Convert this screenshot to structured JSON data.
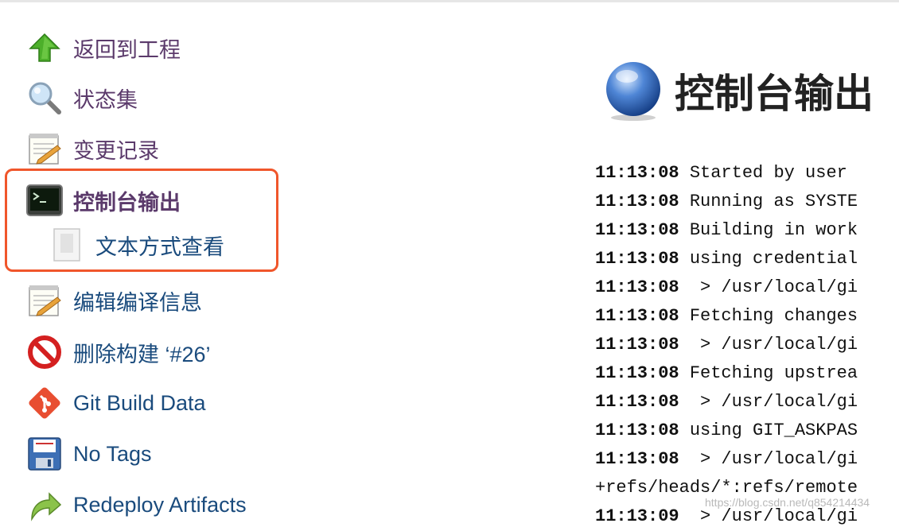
{
  "sidebar": {
    "items": [
      {
        "label": "返回到工程",
        "icon": "up-arrow-icon"
      },
      {
        "label": "状态集",
        "icon": "magnifier-icon"
      },
      {
        "label": "变更记录",
        "icon": "notepad-icon"
      },
      {
        "label": "控制台输出",
        "icon": "terminal-icon"
      },
      {
        "label": "文本方式查看",
        "icon": "document-icon"
      },
      {
        "label": "编辑编译信息",
        "icon": "notepad-icon"
      },
      {
        "label": "删除构建 ‘#26’",
        "icon": "no-entry-icon"
      },
      {
        "label": "Git Build Data",
        "icon": "git-icon"
      },
      {
        "label": "No Tags",
        "icon": "floppy-disk-icon"
      },
      {
        "label": "Redeploy Artifacts",
        "icon": "redeploy-arrow-icon"
      }
    ]
  },
  "main": {
    "title": "控制台输出",
    "title_icon": "blue-ball-icon",
    "console_lines": [
      {
        "ts": "11:13:08",
        "text": " Started by user"
      },
      {
        "ts": "11:13:08",
        "text": " Running as SYSTE"
      },
      {
        "ts": "11:13:08",
        "text": " Building in work"
      },
      {
        "ts": "11:13:08",
        "text": " using credential"
      },
      {
        "ts": "11:13:08",
        "text": "  > /usr/local/gi"
      },
      {
        "ts": "11:13:08",
        "text": " Fetching changes"
      },
      {
        "ts": "11:13:08",
        "text": "  > /usr/local/gi"
      },
      {
        "ts": "11:13:08",
        "text": " Fetching upstrea"
      },
      {
        "ts": "11:13:08",
        "text": "  > /usr/local/gi"
      },
      {
        "ts": "11:13:08",
        "text": " using GIT_ASKPAS"
      },
      {
        "ts": "11:13:08",
        "text": "  > /usr/local/gi"
      },
      {
        "ts": "",
        "text": "+refs/heads/*:refs/remote"
      },
      {
        "ts": "11:13:09",
        "text": "  > /usr/local/gi"
      }
    ]
  },
  "watermark": "https://blog.csdn.net/q854214434",
  "colors": {
    "highlight": "#f0562b",
    "link": "#1a4b7d",
    "visited": "#5b3a6b"
  }
}
